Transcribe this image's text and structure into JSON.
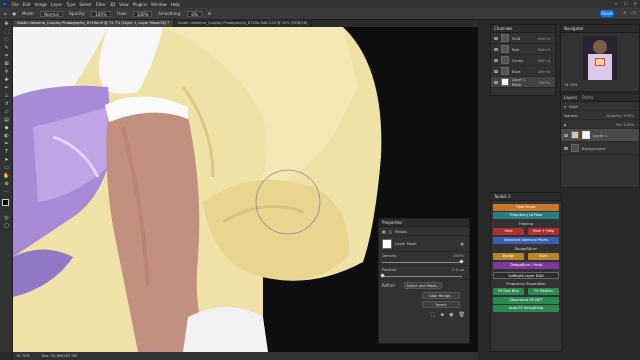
{
  "app": {
    "logo": "Ps"
  },
  "menu": [
    "File",
    "Edit",
    "Image",
    "Layer",
    "Type",
    "Select",
    "Filter",
    "3D",
    "View",
    "Plugins",
    "Window",
    "Help"
  ],
  "options": {
    "mode_label": "Mode:",
    "mode_value": "Normal",
    "opacity_label": "Opacity:",
    "opacity_value": "100%",
    "flow_label": "Flow:",
    "flow_value": "100%",
    "smoothing_label": "Smoothing:",
    "smoothing_value": "0%"
  },
  "share_label": "Share",
  "tabs": [
    {
      "label": "Dustin Valkema_Cosplay Photography_8749e.tif @ 74.7% (Layer 1, Layer Mask/16) *",
      "active": true
    },
    {
      "label": "Dustin Valkema_Cosplay Photography_8749e-Edit-2.tif @ 25% (RGB/16)",
      "active": false
    }
  ],
  "status": {
    "zoom": "74.74%",
    "doc": "Doc: 22.9M/187.5M"
  },
  "channels": {
    "title": "Channels",
    "rows": [
      {
        "name": "RGB",
        "shortcut": "Ctrl+2"
      },
      {
        "name": "Red",
        "shortcut": "Ctrl+3"
      },
      {
        "name": "Green",
        "shortcut": "Ctrl+4"
      },
      {
        "name": "Blue",
        "shortcut": "Ctrl+5"
      },
      {
        "name": "Layer 1 Mask",
        "shortcut": "Ctrl+\\"
      }
    ]
  },
  "navigator": {
    "title": "Navigator",
    "zoom": "74.74%"
  },
  "layers": {
    "title": "Layers",
    "tab2": "Paths",
    "kind": "Kind",
    "blend": "Normal",
    "opacity_label": "Opacity:",
    "opacity_value": "100%",
    "fill_label": "Fill:",
    "fill_value": "100%",
    "rows": [
      {
        "name": "Layer 1"
      },
      {
        "name": "Background"
      }
    ]
  },
  "properties": {
    "title": "Properties",
    "section": "Masks",
    "mask_label": "Layer Mask",
    "density_label": "Density",
    "density_value": "100%",
    "feather_label": "Feather",
    "feather_value": "0.0 px",
    "refine_label": "Refine:",
    "select_mask": "Select and Mask...",
    "color_range": "Color Range...",
    "invert": "Invert"
  },
  "toolkit": {
    "title": "Toolkit 2",
    "buttons": [
      {
        "label": "Heal Brush",
        "color": "#c8782a"
      },
      {
        "label": "Frequency to Fake",
        "color": "#2a7c86"
      },
      {
        "label": "Heal",
        "color": "#b03030"
      },
      {
        "label": "Heal + Help",
        "color": "#b03030"
      },
      {
        "label": "Selective Identical Pixels",
        "color": "#3a5fb0"
      },
      {
        "label": "Dodge",
        "color": "#b8862a"
      },
      {
        "label": "Burn",
        "color": "#b8862a"
      },
      {
        "label": "DodgeBurn / Help",
        "color": "#7a3a9a"
      },
      {
        "label": "Softlight Layer D&B",
        "color": "#2c2c2c"
      },
      {
        "label": "FS Fast Blur",
        "color": "#2a8a52"
      },
      {
        "label": "FS Median",
        "color": "#2a8a52"
      },
      {
        "label": "Separated HF-NET",
        "color": "#2a8a52"
      },
      {
        "label": "Auto FS Smoothing",
        "color": "#2a8a52"
      }
    ],
    "sections": {
      "healing": "Healing",
      "dodgeburn": "Dodge&Burn",
      "frequency": "Frequency Separation"
    }
  }
}
